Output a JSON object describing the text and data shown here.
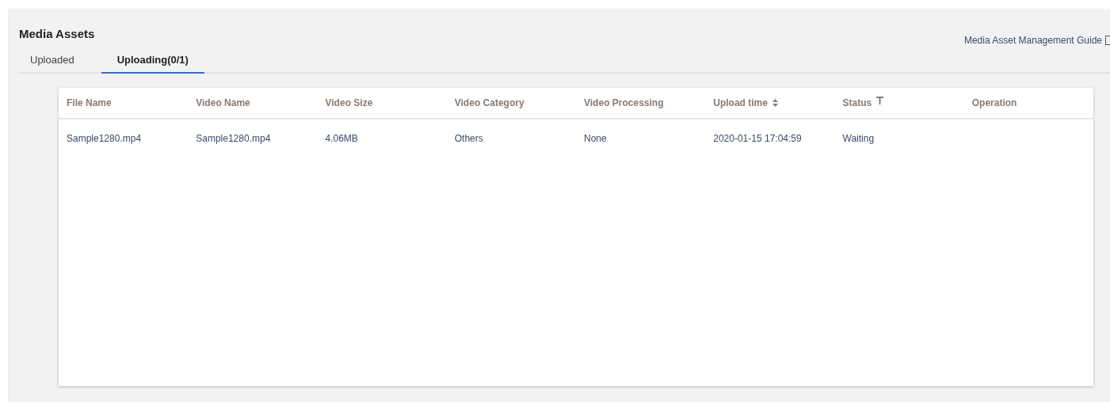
{
  "title": "Media Assets",
  "guide_link": "Media Asset Management Guide",
  "tabs": [
    {
      "label": "Uploaded",
      "selected": false
    },
    {
      "label": "Uploading(0/1)",
      "selected": true
    }
  ],
  "table": {
    "columns": [
      {
        "label": "File Name"
      },
      {
        "label": "Video Name"
      },
      {
        "label": "Video Size"
      },
      {
        "label": "Video Category"
      },
      {
        "label": "Video Processing"
      },
      {
        "label": "Upload time",
        "kind": "sort"
      },
      {
        "label": "Status",
        "kind": "filter"
      },
      {
        "label": "Operation"
      }
    ],
    "rows": [
      [
        "Sample1280.mp4",
        "Sample1280.mp4",
        "4.06MB",
        "Others",
        "None",
        "2020-01-15 17:04:59",
        "Waiting",
        null
      ]
    ]
  }
}
